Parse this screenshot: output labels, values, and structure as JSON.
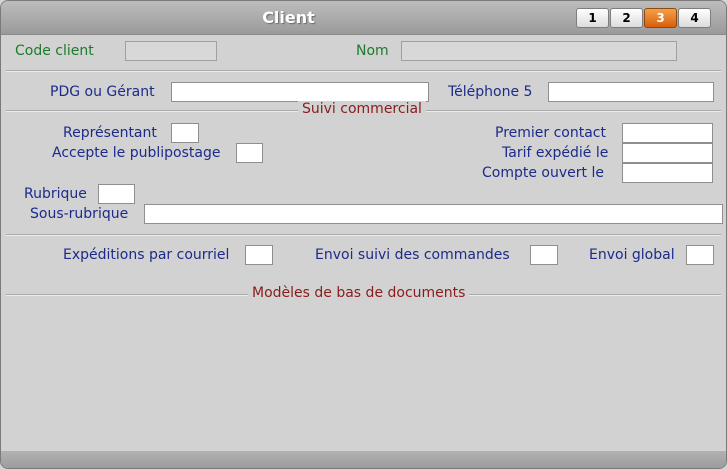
{
  "window": {
    "title": "Client",
    "tabs": [
      {
        "label": "1",
        "active": false
      },
      {
        "label": "2",
        "active": false
      },
      {
        "label": "3",
        "active": true
      },
      {
        "label": "4",
        "active": false
      }
    ]
  },
  "header": {
    "code_client_label": "Code client",
    "code_client_value": "",
    "nom_label": "Nom",
    "nom_value": ""
  },
  "contact": {
    "pdg_label": "PDG ou Gérant",
    "pdg_value": "",
    "telephone_label": "Téléphone 5",
    "telephone_value": ""
  },
  "suivi": {
    "section_title": "Suivi commercial",
    "representant_label": "Représentant",
    "representant_value": "",
    "publipostage_label": "Accepte le publipostage",
    "publipostage_value": "",
    "premier_contact_label": "Premier contact",
    "premier_contact_value": "",
    "tarif_label": "Tarif expédié le",
    "tarif_value": "",
    "compte_label": "Compte ouvert le",
    "compte_value": "",
    "rubrique_label": "Rubrique",
    "rubrique_value": "",
    "sous_rubrique_label": "Sous-rubrique",
    "sous_rubrique_value": ""
  },
  "envois": {
    "courriel_label": "Expéditions par courriel",
    "courriel_value": "",
    "suivi_commandes_label": "Envoi suivi des commandes",
    "suivi_commandes_value": "",
    "global_label": "Envoi global",
    "global_value": ""
  },
  "modeles": {
    "section_title": "Modèles de bas de documents"
  },
  "colors": {
    "window_bg": "#d2d2d2",
    "label_blue": "#1c2a8a",
    "label_green": "#1e7a2a",
    "section_red": "#8a1c1c",
    "active_tab": "#e9761e"
  }
}
